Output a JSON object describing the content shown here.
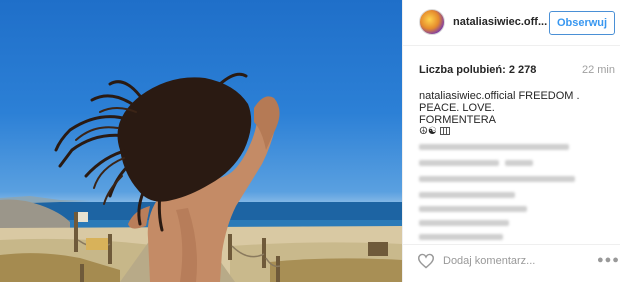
{
  "post": {
    "username": "nataliasiwiec.off...",
    "follow_label": "Obserwuj",
    "likes": "Liczba polubień: 2 278",
    "time": "22 min",
    "caption_author": "nataliasiwiec.official",
    "caption_line1": " FREEDOM .",
    "caption_line2": "PEACE. LOVE.",
    "caption_line3": "FORMENTERA",
    "caption_emoji": "☮☯",
    "comment_placeholder": "Dodaj komentarz...",
    "more_glyph": "●●●"
  },
  "colors": {
    "follow_text": "#3897f0",
    "text": "#262626",
    "muted": "#a0a0a0",
    "sky_top": "#1f6fc9",
    "sea": "#1f6aa8"
  },
  "icons": {
    "like": "heart-icon",
    "more": "more-options-icon",
    "avatar": "avatar"
  }
}
